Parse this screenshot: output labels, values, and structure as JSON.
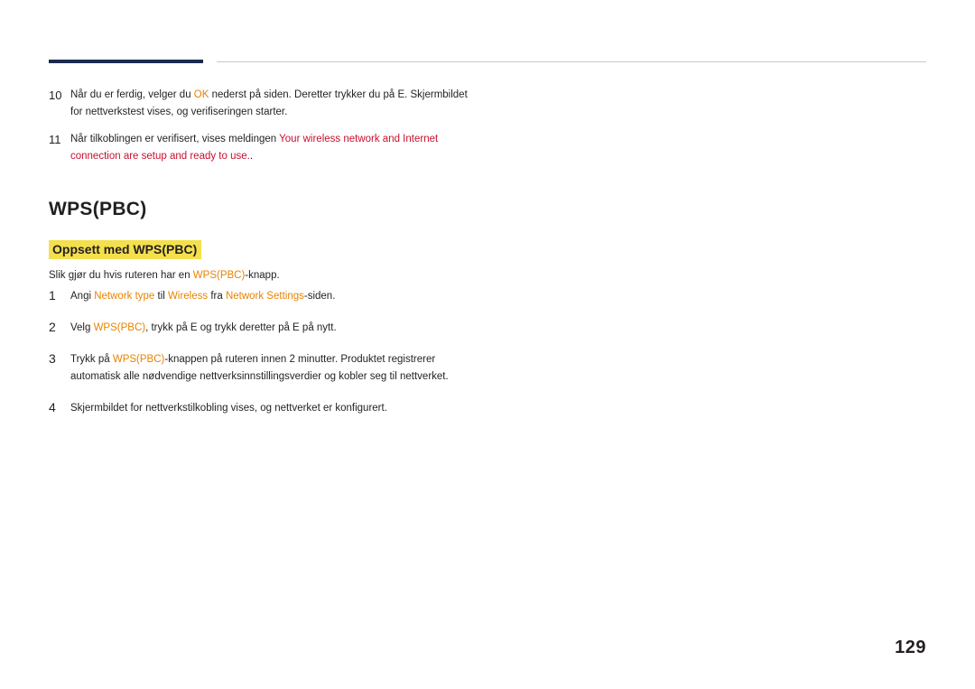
{
  "document": {
    "page_number": "129",
    "section_title": "WPS(PBC)",
    "subsection_title": "Oppsett med WPS(PBC)",
    "intro": {
      "pre": "Slik gjør du hvis ruteren har en ",
      "highlight": "WPS(PBC)",
      "post": "-knapp."
    },
    "top_steps": [
      {
        "num": "10",
        "lines": [
          {
            "parts": [
              {
                "text": "Når du er ferdig, velger du ",
                "style": "normal"
              },
              {
                "text": "OK",
                "style": "orange"
              },
              {
                "text": " nederst på siden. Deretter trykker du på E. Skjermbildet",
                "style": "normal"
              }
            ]
          },
          {
            "parts": [
              {
                "text": "for nettverkstest vises, og verifiseringen starter.",
                "style": "normal"
              }
            ]
          }
        ]
      },
      {
        "num": "11",
        "lines": [
          {
            "parts": [
              {
                "text": "Når tilkoblingen er verifisert, vises meldingen ",
                "style": "normal"
              },
              {
                "text": "Your wireless network and Internet",
                "style": "red"
              }
            ]
          },
          {
            "parts": [
              {
                "text": "connection are setup and ready to use.",
                "style": "red"
              },
              {
                "text": ".",
                "style": "normal"
              }
            ]
          }
        ]
      }
    ],
    "procedure_steps": [
      {
        "num": "1",
        "lines": [
          {
            "parts": [
              {
                "text": "Angi ",
                "style": "normal"
              },
              {
                "text": "Network type",
                "style": "orange"
              },
              {
                "text": " til ",
                "style": "normal"
              },
              {
                "text": "Wireless",
                "style": "orange"
              },
              {
                "text": " fra ",
                "style": "normal"
              },
              {
                "text": "Network Settings",
                "style": "orange"
              },
              {
                "text": "-siden.",
                "style": "normal"
              }
            ]
          }
        ]
      },
      {
        "num": "2",
        "lines": [
          {
            "parts": [
              {
                "text": "Velg ",
                "style": "normal"
              },
              {
                "text": "WPS(PBC)",
                "style": "orange"
              },
              {
                "text": ", trykk på E og trykk deretter på E på nytt.",
                "style": "normal"
              }
            ]
          }
        ]
      },
      {
        "num": "3",
        "lines": [
          {
            "parts": [
              {
                "text": "Trykk på ",
                "style": "normal"
              },
              {
                "text": "WPS(PBC)",
                "style": "orange"
              },
              {
                "text": "-knappen på ruteren innen 2 minutter. Produktet registrerer",
                "style": "normal"
              }
            ]
          },
          {
            "parts": [
              {
                "text": "automatisk alle nødvendige nettverksinnstillingsverdier og kobler seg til nettverket.",
                "style": "normal"
              }
            ]
          }
        ]
      },
      {
        "num": "4",
        "lines": [
          {
            "parts": [
              {
                "text": "Skjermbildet for nettverkstilkobling vises, og nettverket er konfigurert.",
                "style": "normal"
              }
            ]
          }
        ]
      }
    ],
    "colors": {
      "rule_dark": "#1b2a4e",
      "rule_light": "#c8c8c8",
      "highlight": "#f4e04d",
      "accent_orange": "#e98300",
      "accent_red": "#c8102e",
      "text": "#231f20"
    }
  }
}
